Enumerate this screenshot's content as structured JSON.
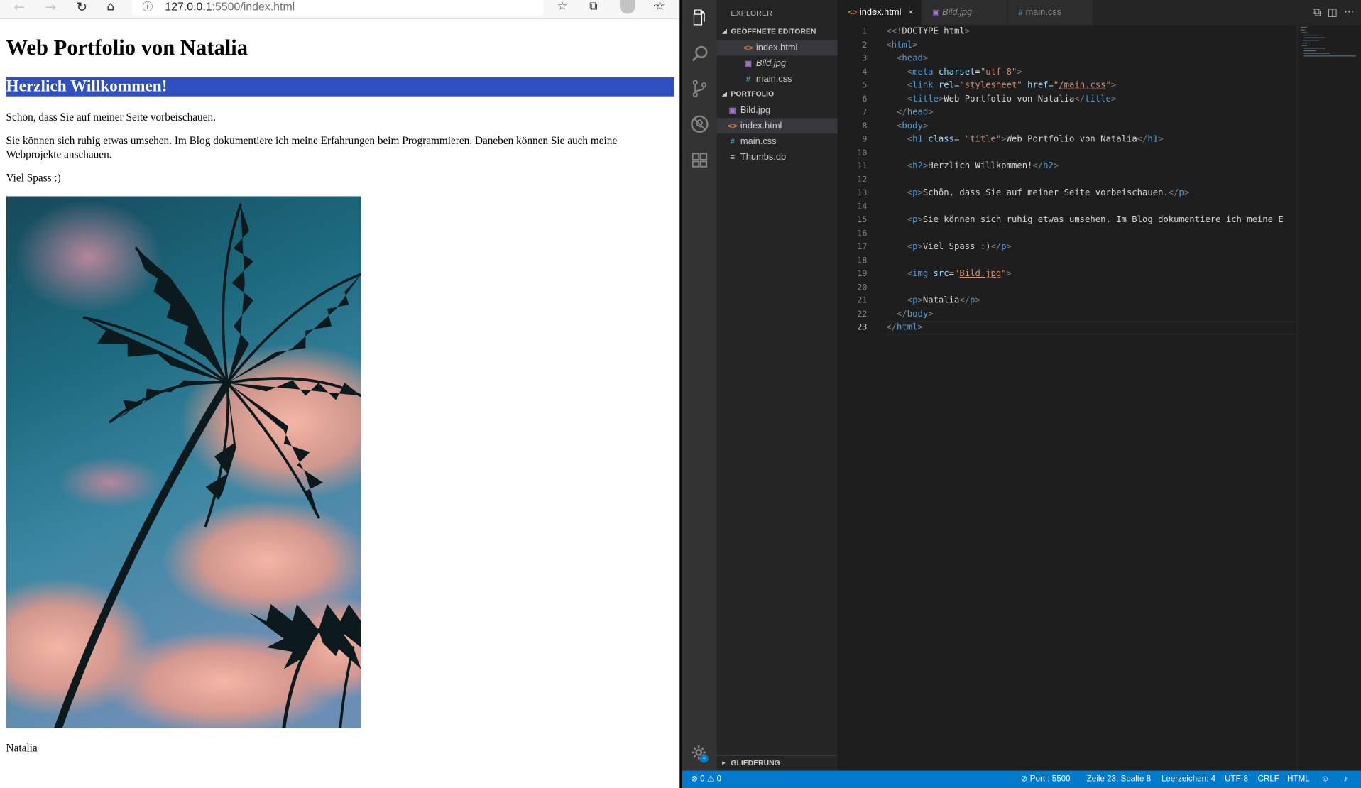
{
  "browser": {
    "url_host": "127.0.0.1",
    "url_path": ":5500/index.html",
    "page": {
      "h1": "Web Portfolio von Natalia",
      "h2": "Herzlich Willkommen!",
      "p1": "Schön, dass Sie auf meiner Seite vorbeischauen.",
      "p2": "Sie können sich ruhig etwas umsehen. Im Blog dokumentiere ich meine Erfahrungen beim Programmieren. Daneben können Sie auch meine Webprojekte anschauen.",
      "p3": "Viel Spass :)",
      "p4": "Natalia"
    },
    "icons": [
      "back-icon",
      "forward-icon",
      "reload-icon",
      "home-icon",
      "info-icon",
      "star-icon",
      "favorites-icon",
      "collections-icon",
      "profile-icon",
      "more-icon"
    ]
  },
  "vscode": {
    "explorer_title": "EXPLORER",
    "open_editors_title": "GEÖFFNETE EDITOREN",
    "open_editors": [
      {
        "name": "index.html",
        "type": "html"
      },
      {
        "name": "Bild.jpg",
        "type": "img"
      },
      {
        "name": "main.css",
        "type": "css"
      }
    ],
    "folder_title": "PORTFOLIO",
    "files": [
      {
        "name": "Bild.jpg",
        "type": "img"
      },
      {
        "name": "index.html",
        "type": "html"
      },
      {
        "name": "main.css",
        "type": "css"
      },
      {
        "name": "Thumbs.db",
        "type": "db"
      }
    ],
    "outline_title": "GLIEDERUNG",
    "tabs": [
      {
        "label": "index.html",
        "close": "×"
      },
      {
        "label": "Bild.jpg"
      },
      {
        "label": "main.css"
      }
    ],
    "line_numbers": [
      "1",
      "2",
      "3",
      "4",
      "5",
      "6",
      "7",
      "8",
      "9",
      "10",
      "11",
      "12",
      "13",
      "14",
      "15",
      "16",
      "17",
      "18",
      "19",
      "20",
      "21",
      "22",
      "23"
    ],
    "code": {
      "l1a": "<!",
      "l1b": "DOCTYPE",
      "l1c": " html",
      "l1d": ">",
      "l2": "html",
      "l3": "head",
      "l4_tag": "meta",
      "l4_attr": "charset",
      "l4_val": "\"utf-8\"",
      "l5_tag": "link",
      "l5_a1": "rel",
      "l5_v1": "\"stylesheet\"",
      "l5_a2": "href",
      "l5_v2a": "\"",
      "l5_v2b": "/main.css",
      "l5_v2c": "\"",
      "l6_tag": "title",
      "l6_text": "Web Portfolio von Natalia",
      "l7": "head",
      "l8": "body",
      "l9_tag": "h1",
      "l9_attr": "class",
      "l9_val": "\"title\"",
      "l9_text": "Web Portfolio von Natalia",
      "l11_tag": "h2",
      "l11_text": "Herzlich Willkommen!",
      "l13_tag": "p",
      "l13_text": "Schön, dass Sie auf meiner Seite vorbeischauen.",
      "l15_tag": "p",
      "l15_text": "Sie können sich ruhig etwas umsehen. Im Blog dokumentiere ich meine E",
      "l17_tag": "p",
      "l17_text": "Viel Spass :)",
      "l19_tag": "img",
      "l19_attr": "src",
      "l19_val_q": "\"",
      "l19_val": "Bild.jpg",
      "l21_tag": "p",
      "l21_text": "Natalia",
      "l22": "body",
      "l23": "html"
    },
    "status": {
      "errors": "0",
      "warnings": "0",
      "port": "Port : 5500",
      "position": "Zeile 23, Spalte 8",
      "spaces": "Leerzeichen: 4",
      "encoding": "UTF-8",
      "eol": "CRLF",
      "language": "HTML"
    },
    "notification_count": "1"
  },
  "colors": {
    "h2_bg": "#3050c0",
    "status_bar": "#007acc",
    "editor_bg": "#1e1e1e",
    "sidebar_bg": "#252526",
    "activity_bar": "#333333"
  }
}
